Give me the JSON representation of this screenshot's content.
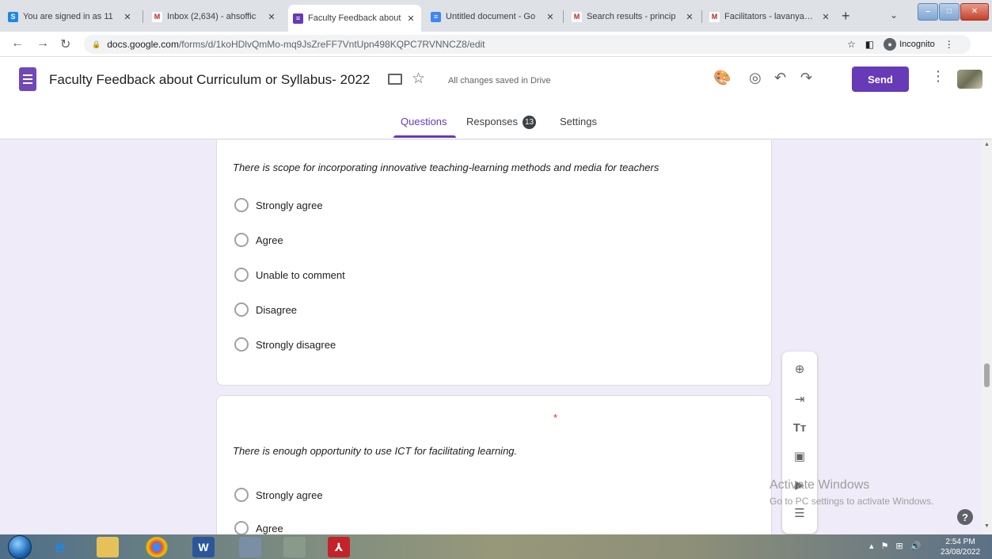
{
  "browser": {
    "tabs": [
      {
        "title": "You are signed in as 11",
        "favicon": "S",
        "color": "#1e88e5"
      },
      {
        "title": "Inbox (2,634) - ahsoffic",
        "favicon": "M",
        "color": "#c5221f"
      },
      {
        "title": "Faculty Feedback about",
        "favicon": "≡",
        "color": "#673ab7"
      },
      {
        "title": "Untitled document - Go",
        "favicon": "≡",
        "color": "#4285f4"
      },
      {
        "title": "Search results - princip",
        "favicon": "M",
        "color": "#c5221f"
      },
      {
        "title": "Facilitators - lavanyap@",
        "favicon": "M",
        "color": "#c5221f"
      }
    ],
    "url_host": "docs.google.com",
    "url_path": "/forms/d/1koHDlvQmMo-mq9JsZreFF7VntUpn498KQPC7RVNNCZ8/edit",
    "incognito_label": "Incognito"
  },
  "header": {
    "title": "Faculty Feedback about Curriculum or Syllabus- 2022",
    "saved": "All changes saved in Drive",
    "send": "Send"
  },
  "form_tabs": {
    "questions": "Questions",
    "responses": "Responses",
    "responses_count": "13",
    "settings": "Settings"
  },
  "questions": [
    {
      "title": "There is scope for incorporating innovative teaching-learning methods and media for teachers",
      "required_mark": "*",
      "options": [
        "Strongly agree",
        "Agree",
        "Unable to comment",
        "Disagree",
        "Strongly disagree"
      ]
    },
    {
      "title": "There is enough opportunity to use ICT for facilitating learning.",
      "required_mark": "*",
      "options": [
        "Strongly agree",
        "Agree"
      ]
    }
  ],
  "watermark": {
    "line1": "Activate Windows",
    "line2": "Go to PC settings to activate Windows."
  },
  "taskbar": {
    "time": "2:54 PM",
    "date": "23/08/2022"
  },
  "colors": {
    "accent": "#673ab7",
    "background": "#f0ebf8",
    "required": "#d93025"
  }
}
